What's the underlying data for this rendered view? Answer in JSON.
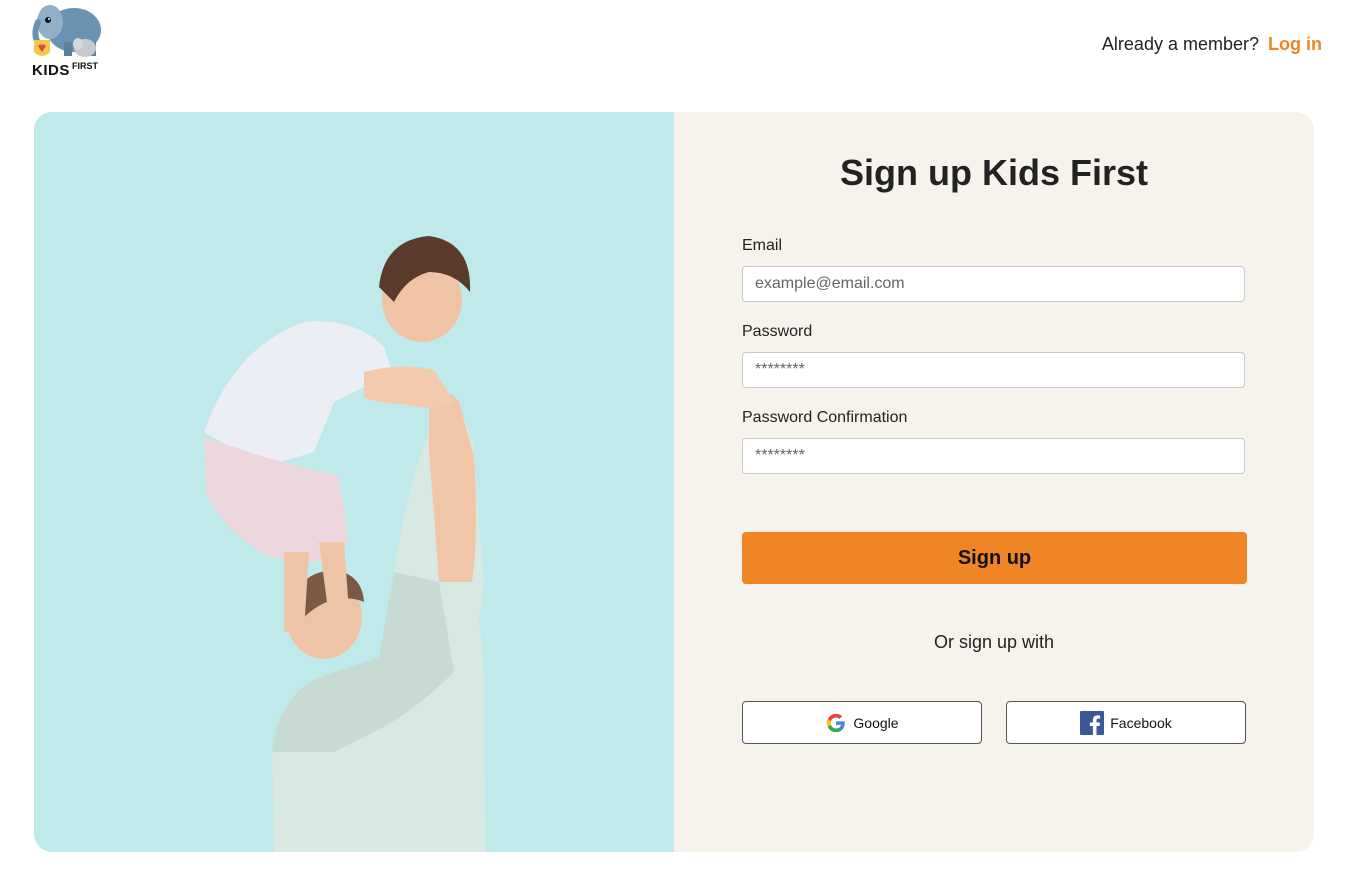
{
  "header": {
    "logo_main": "KIDS",
    "logo_sup": "FIRST",
    "member_prompt": "Already a member?",
    "login_link": "Log in"
  },
  "form": {
    "title": "Sign up Kids First",
    "email_label": "Email",
    "email_placeholder": "example@email.com",
    "password_label": "Password",
    "password_placeholder": "********",
    "confirm_label": "Password Confirmation",
    "confirm_placeholder": "********",
    "submit_label": "Sign up",
    "or_text": "Or sign up with",
    "google_label": "Google",
    "facebook_label": "Facebook"
  },
  "hero": {
    "icon": "parent-lifting-child-photo"
  },
  "colors": {
    "accent": "#f08526",
    "hero_bg": "#bfe9ea",
    "form_bg": "#f6f3ec",
    "facebook": "#3b5998"
  }
}
